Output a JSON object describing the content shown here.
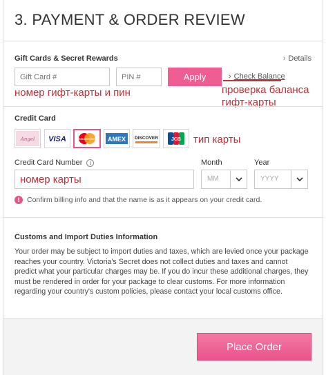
{
  "header": {
    "title": "3. PAYMENT & ORDER REVIEW"
  },
  "gift": {
    "title": "Gift Cards & Secret Rewards",
    "details": "Details",
    "gift_card_placeholder": "Gift Card #",
    "pin_placeholder": "PIN #",
    "apply": "Apply",
    "check_balance": "Check Balance"
  },
  "annotations": {
    "gift_pin": "номер гифт-карты и пин",
    "check_balance_1": "проверка баланса",
    "check_balance_2": "гифт-карты",
    "card_type": "тип карты",
    "card_number": "номер карты"
  },
  "credit": {
    "title": "Credit Card",
    "cards": [
      {
        "name": "Angel",
        "icon": "angel-card-icon"
      },
      {
        "name": "VISA",
        "icon": "visa-icon"
      },
      {
        "name": "MasterCard",
        "icon": "mastercard-icon",
        "selected": true
      },
      {
        "name": "AMEX",
        "icon": "amex-icon"
      },
      {
        "name": "DISCOVER",
        "icon": "discover-icon"
      },
      {
        "name": "JCB",
        "icon": "jcb-icon"
      }
    ],
    "number_label": "Credit Card Number",
    "month_label": "Month",
    "year_label": "Year",
    "month_placeholder": "MM",
    "year_placeholder": "YYYY",
    "warning": "Confirm billing info and that the name is as it appears on your credit card."
  },
  "customs": {
    "title": "Customs and Import Duties Information",
    "text": "Your order may be subject to import duties and taxes, which are levied once your package reaches your country. Victoria's Secret does not collect duties and taxes and cannot predict what your particular charges may be. If you do incur these additional charges, they must be rendered in order for your package to clear customs. For more information regarding your country's custom policies, please contact your local customs office."
  },
  "footer": {
    "place_order": "Place Order"
  },
  "colors": {
    "accent": "#ee5e93",
    "annotation": "#b6333a"
  }
}
